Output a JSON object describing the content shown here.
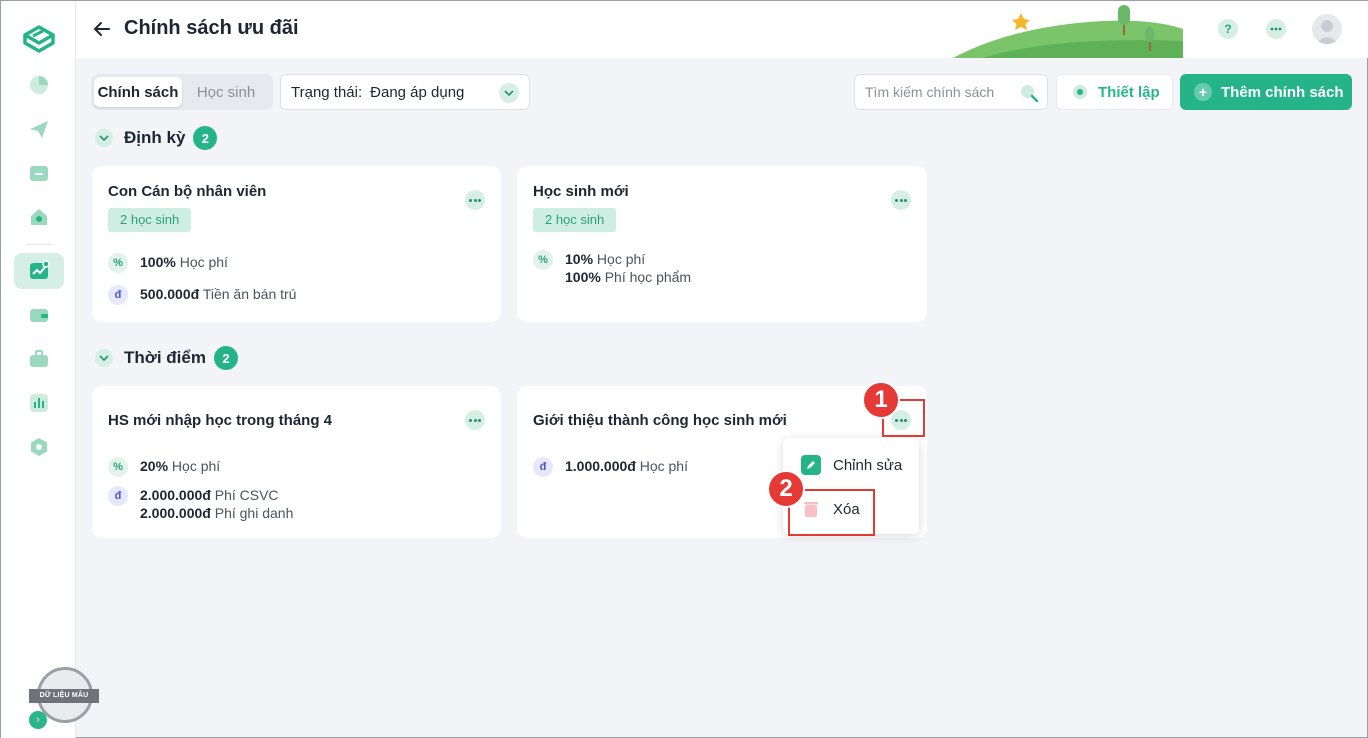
{
  "header": {
    "title": "Chính sách ưu đãi",
    "help_label": "?"
  },
  "toolbar": {
    "tabs": [
      {
        "label": "Chính sách",
        "active": true
      },
      {
        "label": "Học sinh",
        "active": false
      }
    ],
    "status": {
      "label": "Trạng thái:",
      "value": "Đang áp dụng"
    },
    "search": {
      "placeholder": "Tìm kiếm chính sách",
      "value": ""
    },
    "setup_label": "Thiết lập",
    "add_label": "Thêm chính sách",
    "add_plus": "+"
  },
  "sections": [
    {
      "title": "Định kỳ",
      "count": "2",
      "cards": [
        {
          "title": "Con Cán bộ nhân viên",
          "tag": "2 học sinh",
          "rows": [
            {
              "icon": "%",
              "amounts": [
                {
                  "value": "100%",
                  "label": "Học phí"
                }
              ]
            },
            {
              "icon": "đ",
              "amounts": [
                {
                  "value": "500.000đ",
                  "label": "Tiền ăn bán trú"
                }
              ]
            }
          ]
        },
        {
          "title": "Học sinh mới",
          "tag": "2 học sinh",
          "rows": [
            {
              "icon": "%",
              "amounts": [
                {
                  "value": "10%",
                  "label": "Học phí"
                },
                {
                  "value": "100%",
                  "label": "Phí học phẩm"
                }
              ]
            }
          ]
        }
      ]
    },
    {
      "title": "Thời điểm",
      "count": "2",
      "cards": [
        {
          "title": "HS mới nhập học trong tháng 4",
          "rows": [
            {
              "icon": "%",
              "amounts": [
                {
                  "value": "20%",
                  "label": "Học phí"
                }
              ]
            },
            {
              "icon": "đ",
              "amounts": [
                {
                  "value": "2.000.000đ",
                  "label": "Phí CSVC"
                },
                {
                  "value": "2.000.000đ",
                  "label": "Phí ghi danh"
                }
              ]
            }
          ]
        },
        {
          "title": "Giới thiệu thành công học sinh mới",
          "rows": [
            {
              "icon": "đ",
              "amounts": [
                {
                  "value": "1.000.000đ",
                  "label": "Học phí"
                }
              ]
            }
          ]
        }
      ]
    }
  ],
  "context_menu": {
    "items": [
      {
        "label": "Chỉnh sửa",
        "icon": "pencil-icon"
      },
      {
        "label": "Xóa",
        "icon": "trash-icon"
      }
    ]
  },
  "annotations": {
    "step1": "1",
    "step2": "2"
  },
  "sidebar": {
    "stamp_text": "DỮ LIỆU MẪU",
    "expand_glyph": "›",
    "items": [
      "chart-pie-icon",
      "send-icon",
      "folder-icon",
      "home-heart-icon",
      "trend-chart-icon",
      "wallet-icon",
      "briefcase-icon",
      "bar-chart-icon",
      "settings-icon"
    ]
  },
  "colors": {
    "accent": "#25b488",
    "accent_light": "#d5efe4",
    "annotation_red": "#e53935"
  }
}
